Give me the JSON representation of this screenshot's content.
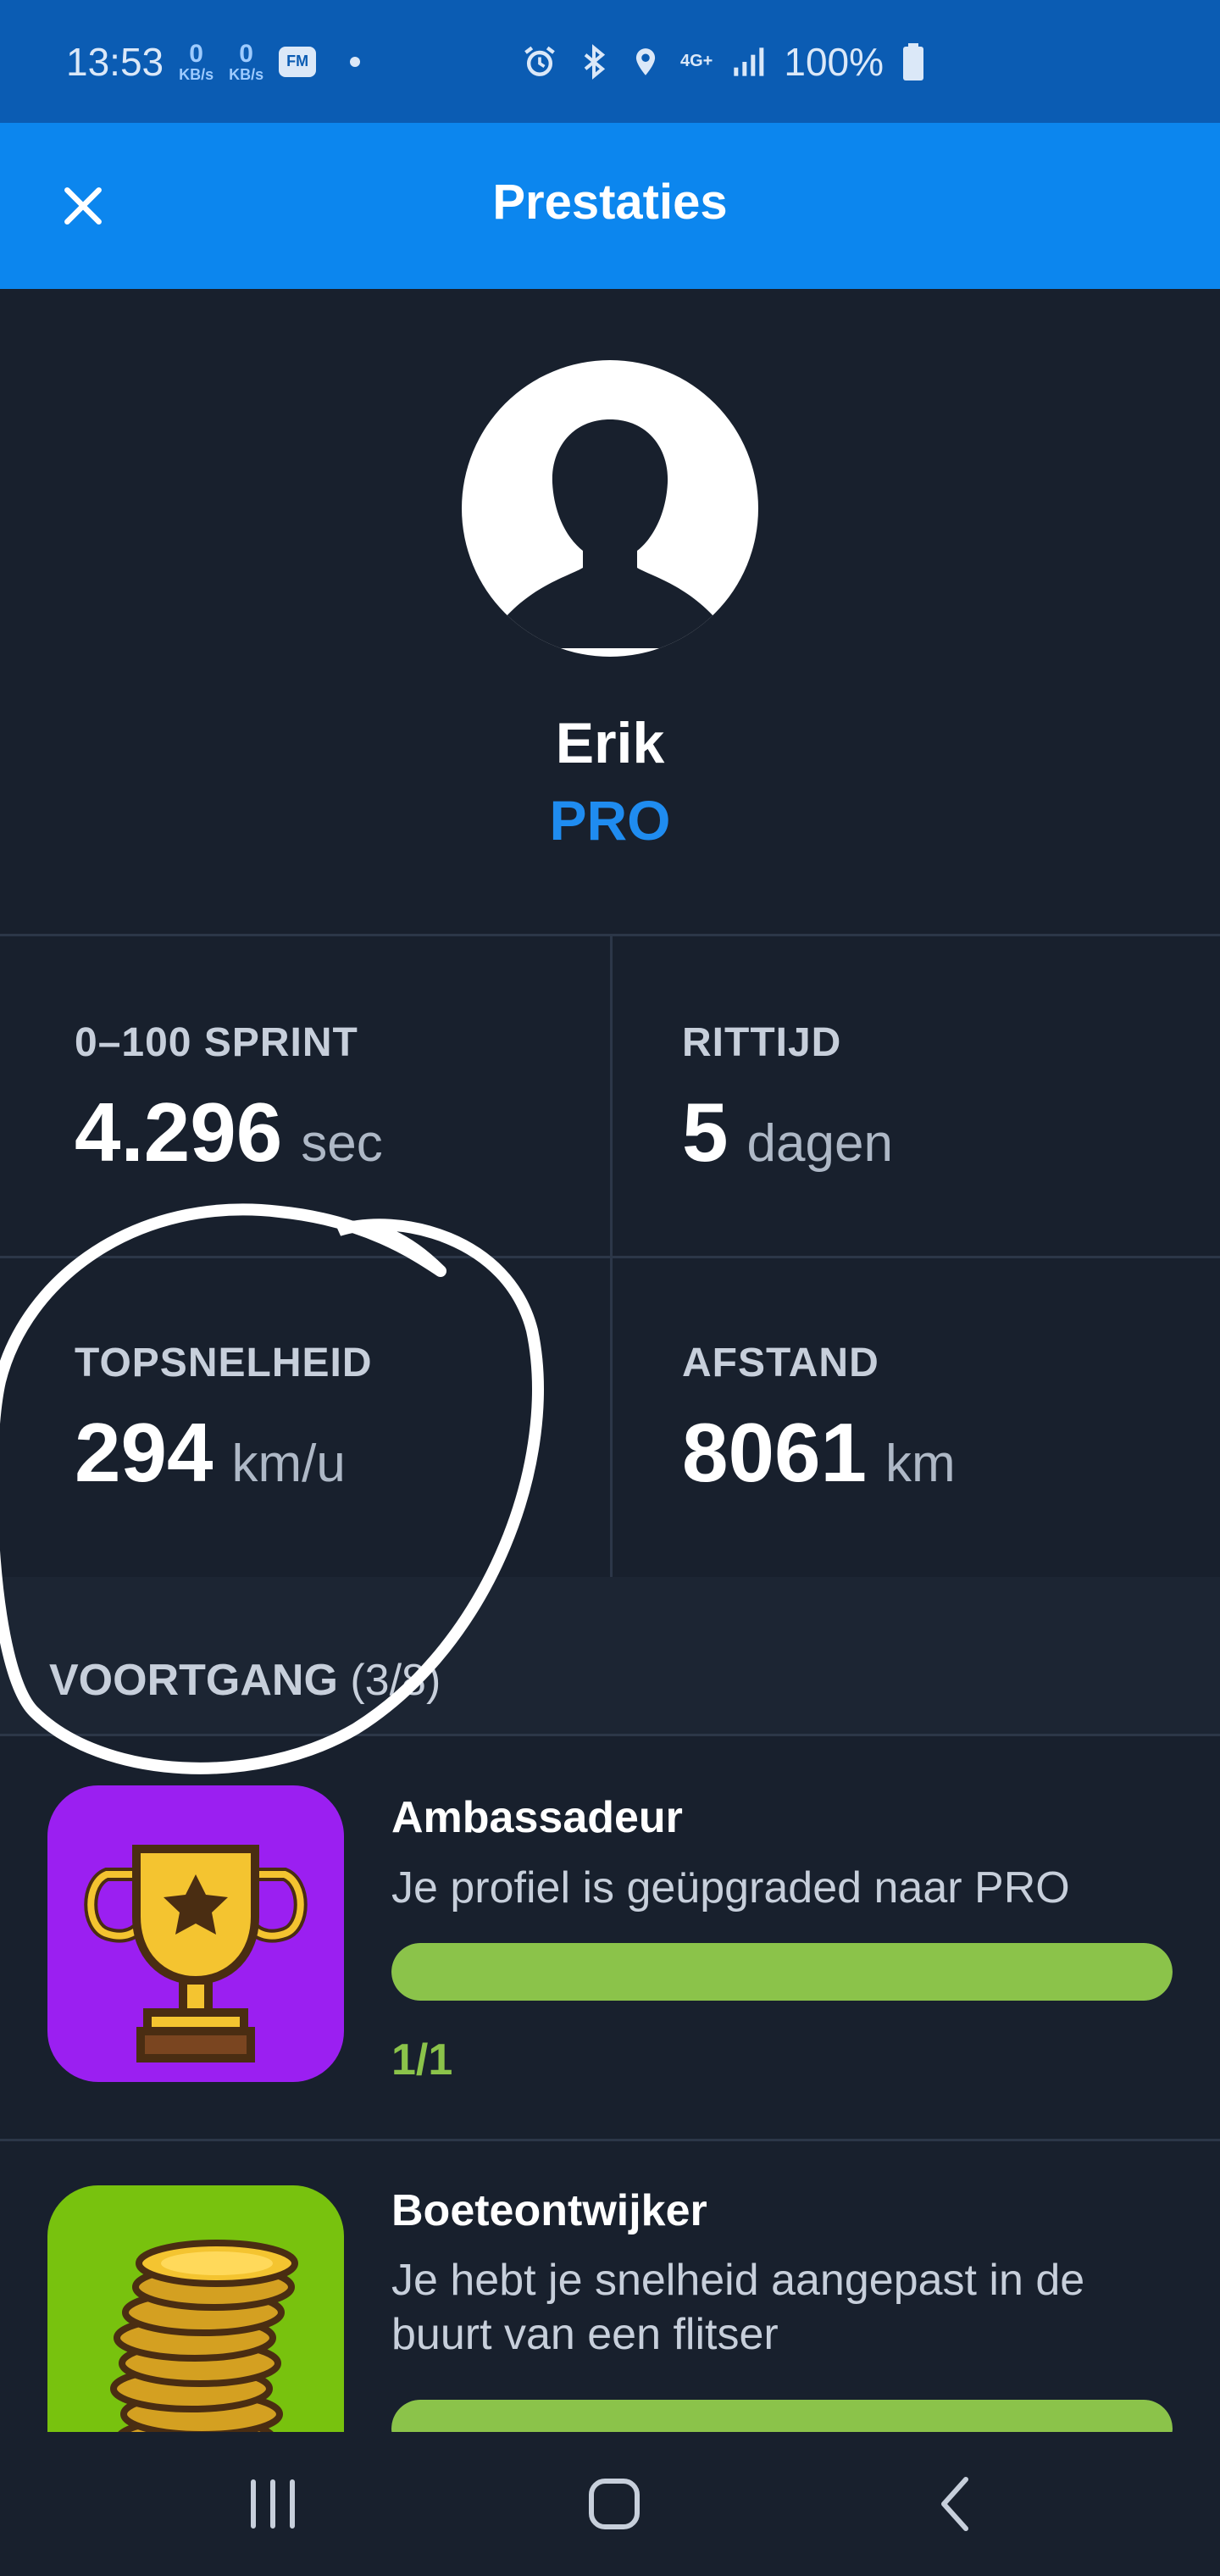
{
  "status_bar": {
    "time": "13:53",
    "net_down_value": "0",
    "net_down_unit": "KB/s",
    "net_up_value": "0",
    "net_up_unit": "KB/s",
    "fm_label": "FM",
    "network_type": "4G+",
    "battery": "100%"
  },
  "app_bar": {
    "title": "Prestaties",
    "close_icon": "close-icon"
  },
  "profile": {
    "name": "Erik",
    "badge": "PRO"
  },
  "stats": [
    {
      "label": "0–100 SPRINT",
      "value": "4.296",
      "unit": "sec"
    },
    {
      "label": "RITTIJD",
      "value": "5",
      "unit": "dagen"
    },
    {
      "label": "TOPSNELHEID",
      "value": "294",
      "unit": "km/u"
    },
    {
      "label": "AFSTAND",
      "value": "8061",
      "unit": "km"
    }
  ],
  "progress": {
    "label": "VOORTGANG",
    "count": "(3/8)"
  },
  "achievements": [
    {
      "title": "Ambassadeur",
      "description": "Je profiel is geüpgraded naar PRO",
      "progress_fraction": 1.0,
      "count": "1/1",
      "icon": "trophy-icon",
      "icon_bg": "#9b1ff1"
    },
    {
      "title": "Boeteontwijker",
      "description": "Je hebt je snelheid aangepast in de buurt van een flitser",
      "progress_fraction": 1.0,
      "icon": "coins-icon",
      "icon_bg": "#78c20e"
    }
  ],
  "colors": {
    "status_bar": "#0b5cb3",
    "app_bar": "#0c86ee",
    "background": "#18202d",
    "accent_blue": "#1f8cf0",
    "progress_green": "#8bc34a"
  }
}
